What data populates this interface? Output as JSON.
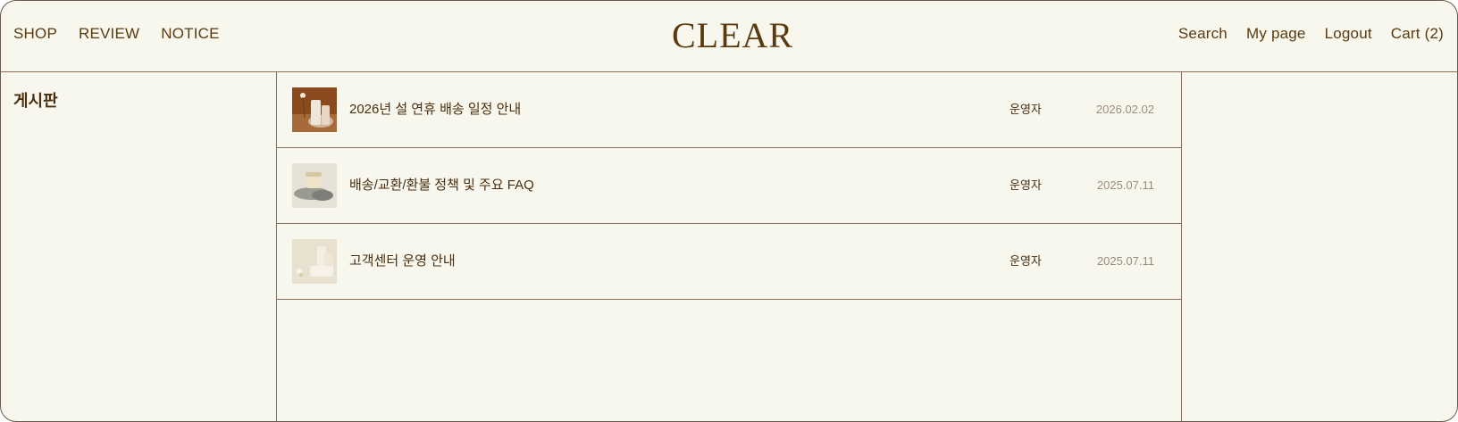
{
  "header": {
    "nav_left": [
      "SHOP",
      "REVIEW",
      "NOTICE"
    ],
    "logo": "CLEAR",
    "nav_right": {
      "search": "Search",
      "mypage": "My page",
      "logout": "Logout",
      "cart": "Cart (2)"
    }
  },
  "sidebar": {
    "title": "게시판"
  },
  "posts": [
    {
      "title": "2026년 설 연휴 배송 일정 안내",
      "author": "운영자",
      "date": "2026.02.02",
      "thumb": "product-photo-brown"
    },
    {
      "title": "배송/교환/환불 정책 및 주요 FAQ",
      "author": "운영자",
      "date": "2025.07.11",
      "thumb": "product-photo-stones"
    },
    {
      "title": "고객센터 운영 안내",
      "author": "운영자",
      "date": "2025.07.11",
      "thumb": "product-photo-cream"
    }
  ],
  "colors": {
    "background": "#f8f7ee",
    "text": "#5a3a10",
    "divider": "#8a6f5a",
    "date": "#9b8c7a"
  }
}
